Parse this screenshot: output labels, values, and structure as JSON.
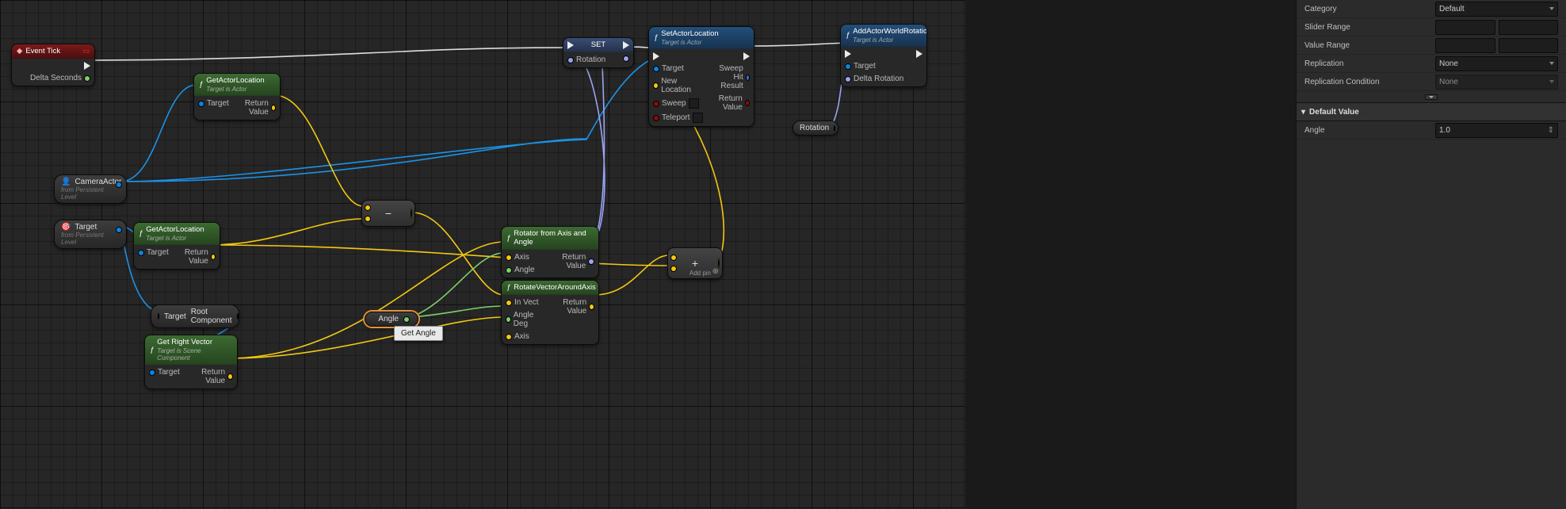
{
  "details": {
    "rows": {
      "category_label": "Category",
      "category_value": "Default",
      "slider_label": "Slider Range",
      "value_label": "Value Range",
      "replication_label": "Replication",
      "replication_value": "None",
      "repcond_label": "Replication Condition",
      "repcond_value": "None"
    },
    "section_default": "Default Value",
    "angle_label": "Angle",
    "angle_value": "1.0"
  },
  "tooltip": "Get Angle",
  "nodes": {
    "event_tick": {
      "title": "Event Tick",
      "delta": "Delta Seconds"
    },
    "get_loc1": {
      "title": "GetActorLocation",
      "sub": "Target is Actor",
      "in": [
        "Target"
      ],
      "out": [
        "Return Value"
      ]
    },
    "get_loc2": {
      "title": "GetActorLocation",
      "sub": "Target is Actor",
      "in": [
        "Target"
      ],
      "out": [
        "Return Value"
      ]
    },
    "get_right": {
      "title": "Get Right Vector",
      "sub": "Target is Scene Component",
      "in": [
        "Target"
      ],
      "out": [
        "Return Value"
      ]
    },
    "rot_axis": {
      "title": "Rotator from Axis and Angle",
      "in": [
        "Axis",
        "Angle"
      ],
      "out": [
        "Return Value"
      ]
    },
    "rot_vec": {
      "title": "RotateVectorAroundAxis",
      "in": [
        "In Vect",
        "Angle Deg",
        "Axis"
      ],
      "out": [
        "Return Value"
      ]
    },
    "set_loc": {
      "title": "SetActorLocation",
      "sub": "Target is Actor",
      "in": [
        "Target",
        "New Location",
        "Sweep",
        "Teleport"
      ],
      "out": [
        "Sweep Hit Result",
        "Return Value"
      ]
    },
    "add_rot": {
      "title": "AddActorWorldRotation",
      "sub": "Target is Actor",
      "in": [
        "Target",
        "Delta Rotation"
      ]
    },
    "set_var": {
      "title": "SET",
      "in": [
        "Rotation"
      ],
      "out": [
        "Rotation"
      ]
    }
  },
  "vars": {
    "camera": {
      "title": "CameraActor",
      "sub": "from Persistent Level"
    },
    "target": {
      "title": "Target",
      "sub": "from Persistent Level"
    },
    "root": {
      "in": "Target",
      "out": "Root Component"
    },
    "angle": "Angle",
    "rotation": "Rotation"
  },
  "math": {
    "minus": "−",
    "plus": "+",
    "addpin": "Add pin"
  }
}
